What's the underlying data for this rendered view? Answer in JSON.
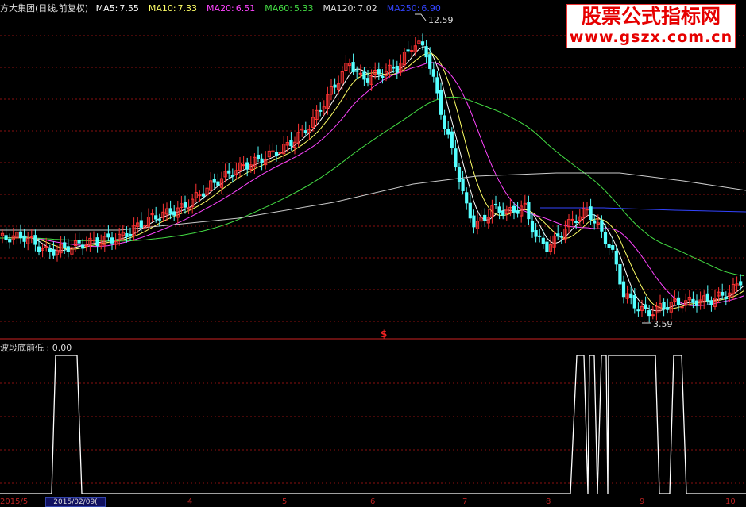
{
  "header": {
    "symbol": "方大集团(日线,前复权)",
    "ma_items": [
      {
        "label": "MA5:",
        "value": "7.55",
        "color": "#ffffff"
      },
      {
        "label": "MA10:",
        "value": "7.33",
        "color": "#ffff66"
      },
      {
        "label": "MA20:",
        "value": "6.51",
        "color": "#ff44ff"
      },
      {
        "label": "MA60:",
        "value": "5.33",
        "color": "#44dd44"
      },
      {
        "label": "MA120:",
        "value": "7.02",
        "color": "#dddddd"
      },
      {
        "label": "MA250:",
        "value": "6.90",
        "color": "#3344ff"
      }
    ]
  },
  "watermark": {
    "name": "股票公式指标网",
    "url": "www.gszx.com.cn"
  },
  "price_panel": {
    "high_label": "12.59",
    "low_label": "3.59",
    "marker": "$"
  },
  "indicator_panel": {
    "title": "波段底前低 : 0.00"
  },
  "time_axis": {
    "selected_date": "2015/02/09(",
    "left_label": "2015/5",
    "ticks": [
      "4",
      "5",
      "6",
      "7",
      "8",
      "9",
      "10"
    ]
  },
  "colors": {
    "up": "#ff3333",
    "down": "#55ffff",
    "grid": "#8a1010",
    "separator": "#cc2222",
    "indicator_line": "#ffffff"
  }
}
